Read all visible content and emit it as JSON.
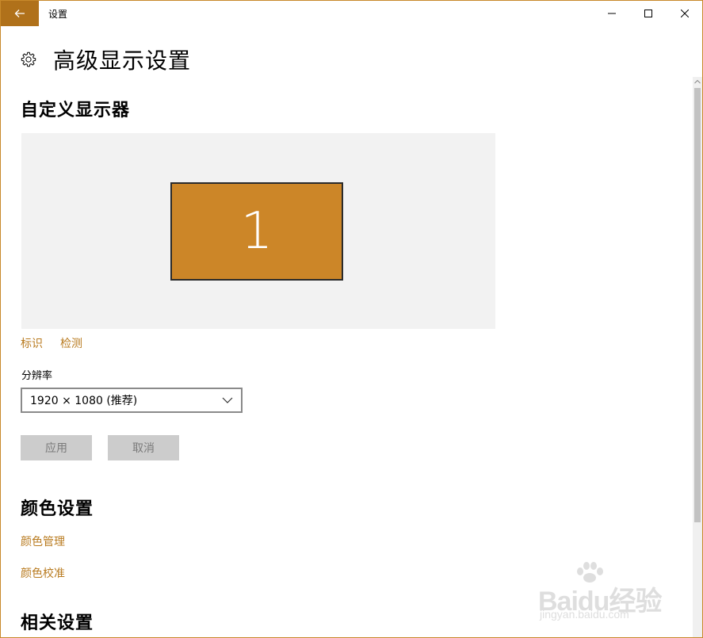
{
  "window": {
    "title": "设置",
    "accent": "#b0711a",
    "controls": {
      "minimize": "minimize-icon",
      "maximize": "maximize-icon",
      "close": "close-icon"
    }
  },
  "header": {
    "title": "高级显示设置",
    "icon": "gear-icon"
  },
  "custom_display": {
    "section_title": "自定义显示器",
    "monitor_label": "1",
    "monitor_color": "#cc8628",
    "links": {
      "identify": "标识",
      "detect": "检测"
    }
  },
  "resolution": {
    "label": "分辨率",
    "value": "1920 × 1080 (推荐)"
  },
  "buttons": {
    "apply": "应用",
    "cancel": "取消"
  },
  "color_settings": {
    "section_title": "颜色设置",
    "links": {
      "color_management": "颜色管理",
      "color_calibration": "颜色校准"
    }
  },
  "related_settings": {
    "section_title": "相关设置"
  },
  "watermark": {
    "brand": "Baidu经验",
    "url": "jingyan.baidu.com"
  }
}
